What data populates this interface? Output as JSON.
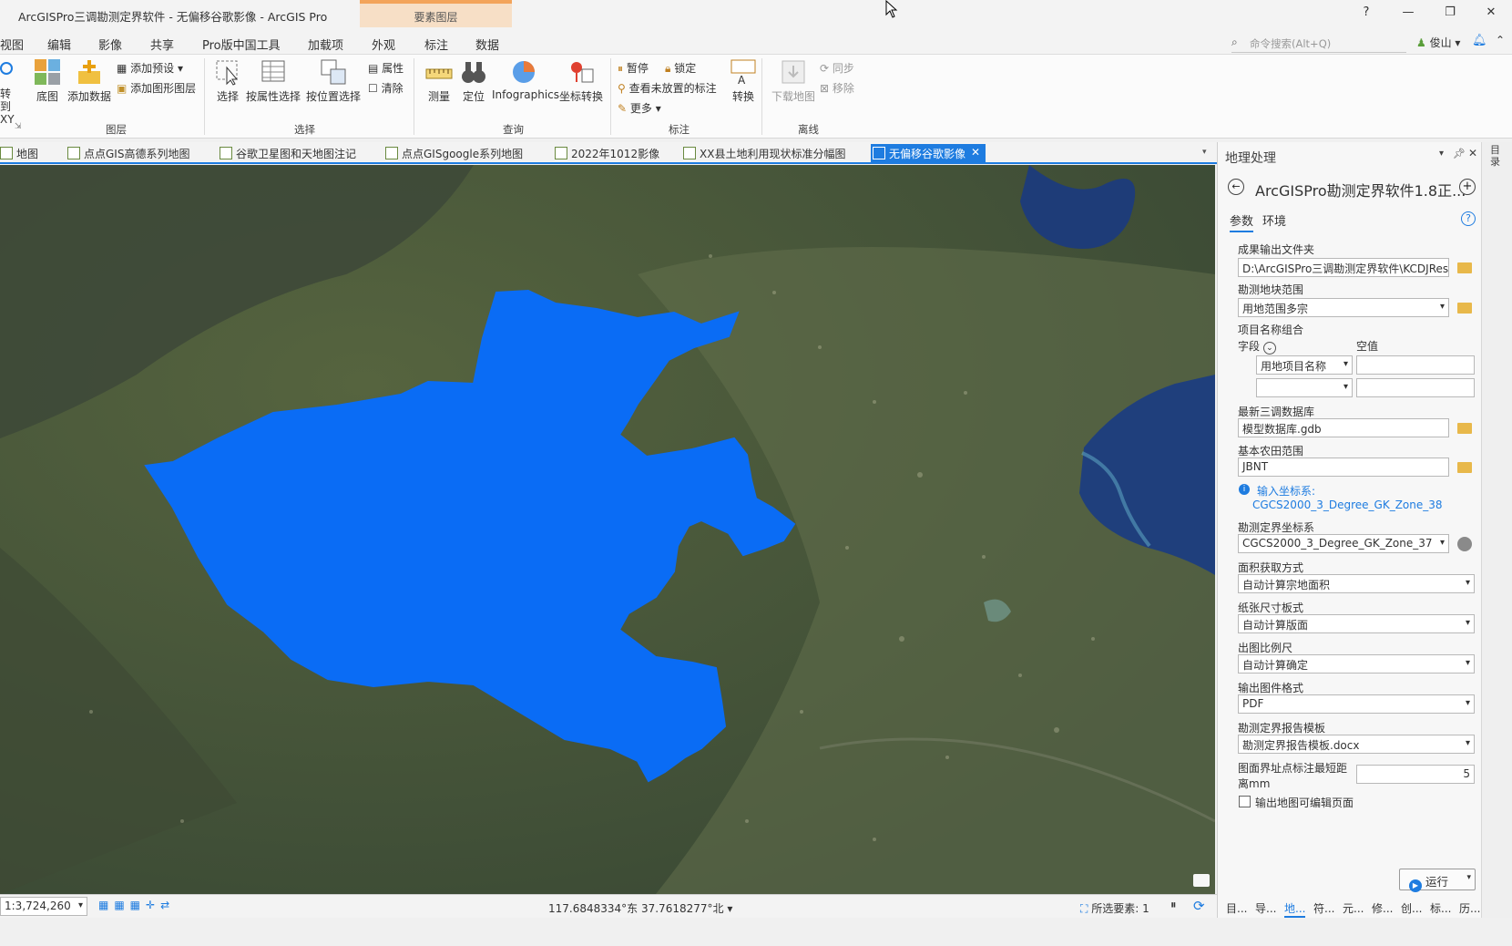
{
  "window": {
    "title": "ArcGISPro三调勘测定界软件 - 无偏移谷歌影像 - ArcGIS Pro",
    "context_tab": "要素图层",
    "help": "?",
    "minimize": "—",
    "restore": "❐",
    "close": "✕"
  },
  "menu": {
    "items": [
      "视图",
      "编辑",
      "影像",
      "共享",
      "Pro版中国工具",
      "加载项",
      "外观",
      "标注",
      "数据"
    ],
    "search_placeholder": "命令搜索(Alt+Q)",
    "user": "俊山"
  },
  "ribbon": {
    "goto_xy": "转到\nXY",
    "basemap": "底图",
    "add_data": "添加数据",
    "add_preset": "添加预设",
    "add_graphics_layer": "添加图形图层",
    "group_layer": "图层",
    "select": "选择",
    "select_by_attr": "按属性选择",
    "select_by_loc": "按位置选择",
    "attributes": "属性",
    "clear": "清除",
    "group_select": "选择",
    "measure": "测量",
    "locate": "定位",
    "infographics": "Infographics",
    "coord_convert": "坐标转换",
    "group_query": "查询",
    "pause": "暂停",
    "lock": "锁定",
    "view_unplaced": "查看未放置的标注",
    "more": "更多",
    "convert": "转换",
    "group_label": "标注",
    "download_map": "下载地图",
    "sync": "同步",
    "remove": "移除",
    "group_offline": "离线"
  },
  "doc_tabs": [
    "地图",
    "点点GIS高德系列地图",
    "谷歌卫星图和天地图注记",
    "点点GISgoogle系列地图",
    "2022年1012影像",
    "XX县土地利用现状标准分幅图",
    "无偏移谷歌影像"
  ],
  "status": {
    "scale": "1:3,724,260",
    "coordinates": "117.6848334°东 37.7618277°北",
    "selected_features": "所选要素: 1"
  },
  "gp": {
    "pane_title": "地理处理",
    "tool_title": "ArcGISPro勘测定界软件1.8正...",
    "tab_params": "参数",
    "tab_env": "环境",
    "output_folder_label": "成果输出文件夹",
    "output_folder_value": "D:\\ArcGISPro三调勘测定界软件\\KCDJRes",
    "survey_extent_label": "勘测地块范围",
    "survey_extent_value": "用地范围多宗",
    "project_name_label": "项目名称组合",
    "field_label": "字段",
    "null_label": "空值",
    "field_value_1": "用地项目名称",
    "latest_db_label": "最新三调数据库",
    "latest_db_value": "模型数据库.gdb",
    "farmland_label": "基本农田范围",
    "farmland_value": "JBNT",
    "input_cs_label": "输入坐标系:",
    "input_cs_value": "CGCS2000_3_Degree_GK_Zone_38",
    "survey_cs_label": "勘测定界坐标系",
    "survey_cs_value": "CGCS2000_3_Degree_GK_Zone_37",
    "area_method_label": "面积获取方式",
    "area_method_value": "自动计算宗地面积",
    "paper_size_label": "纸张尺寸板式",
    "paper_size_value": "自动计算版面",
    "map_scale_label": "出图比例尺",
    "map_scale_value": "自动计算确定",
    "output_format_label": "输出图件格式",
    "output_format_value": "PDF",
    "report_template_label": "勘测定界报告模板",
    "report_template_value": "勘测定界报告模板.docx",
    "min_dist_label_1": "图面界址点标注最短距",
    "min_dist_label_2": "离mm",
    "min_dist_value": "5",
    "editable_label": "输出地图可编辑页面",
    "run": "运行"
  },
  "side_rail": "目录",
  "bottom_tabs": [
    "目...",
    "导...",
    "地...",
    "符...",
    "元...",
    "修...",
    "创...",
    "标...",
    "历..."
  ],
  "colors": {
    "polygon_fill": "#0a6cf5",
    "accent": "#1e7ce0",
    "context_tab": "#f7dfc6"
  }
}
